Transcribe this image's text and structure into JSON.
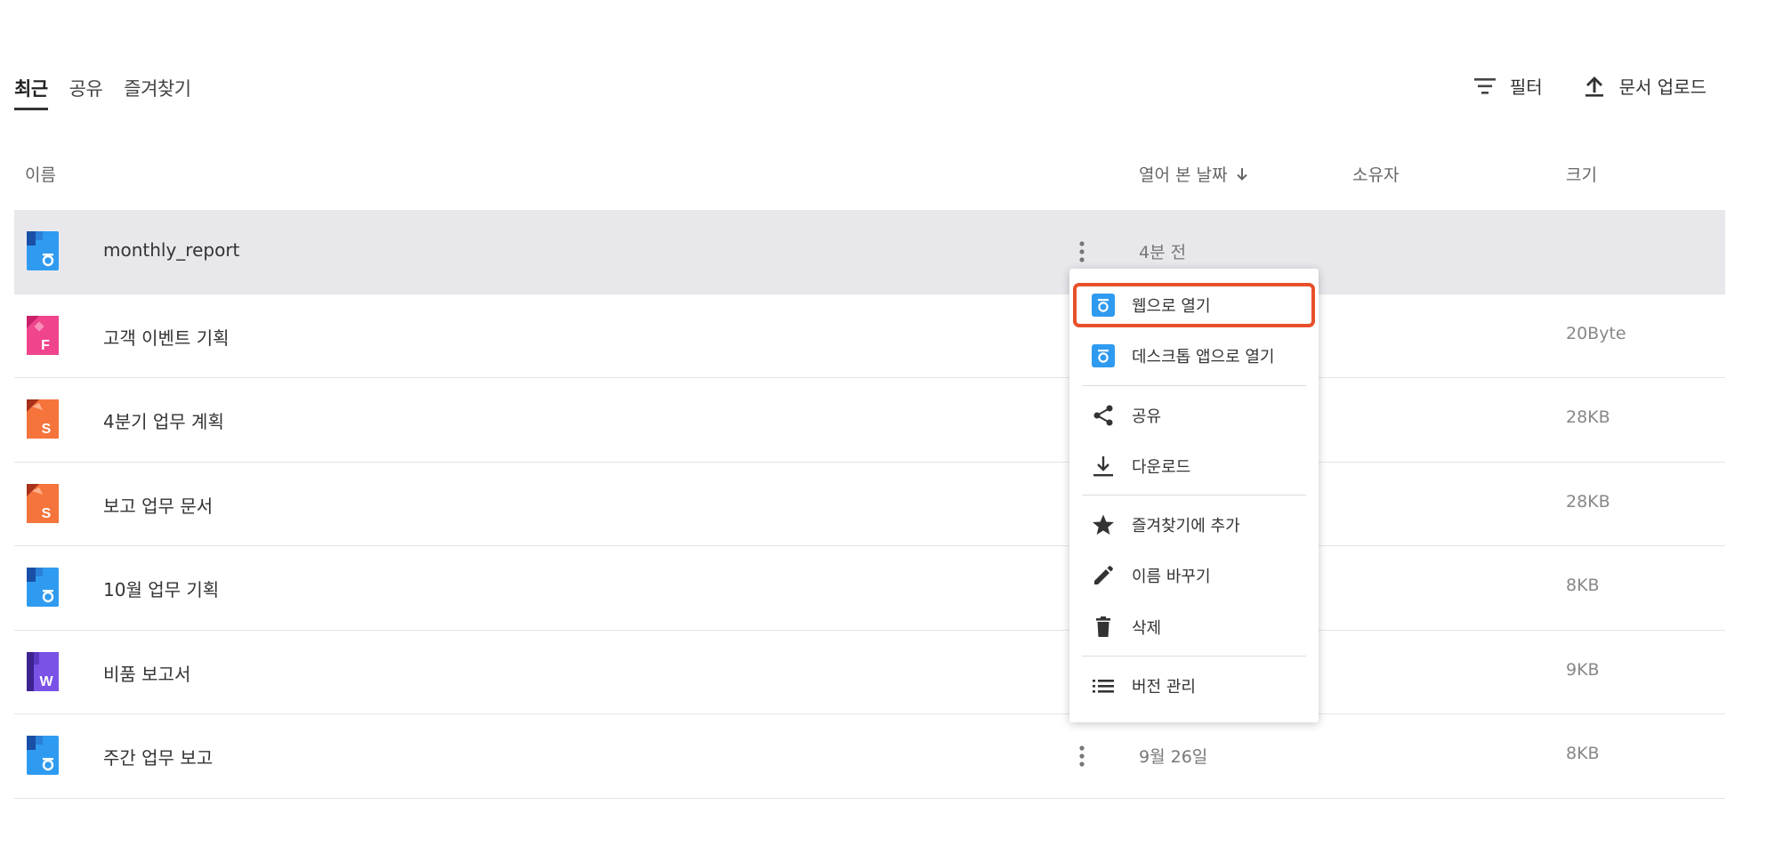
{
  "tabs": [
    {
      "label": "최근",
      "active": true
    },
    {
      "label": "공유",
      "active": false
    },
    {
      "label": "즐겨찾기",
      "active": false
    }
  ],
  "toolbar": {
    "filter_label": "필터",
    "upload_label": "문서 업로드"
  },
  "table": {
    "columns": {
      "name": "이름",
      "opened": "열어 본 날짜",
      "owner": "소유자",
      "size": "크기"
    },
    "rows": [
      {
        "name": "monthly_report",
        "type": "hancom-doc",
        "date": "4분 전",
        "size": "",
        "selected": true
      },
      {
        "name": "고객 이벤트 기획",
        "type": "form-doc",
        "date": "",
        "size": "20Byte"
      },
      {
        "name": "4분기 업무 계획",
        "type": "sheet-doc",
        "date": "",
        "size": "28KB"
      },
      {
        "name": "보고 업무 문서",
        "type": "sheet-doc",
        "date": "",
        "size": "28KB"
      },
      {
        "name": "10월 업무 기획",
        "type": "hancom-doc",
        "date": "",
        "size": "8KB"
      },
      {
        "name": "비품 보고서",
        "type": "word-doc",
        "date": "",
        "size": "9KB"
      },
      {
        "name": "주간 업무 보고",
        "type": "hancom-doc",
        "date": "9월 26일",
        "size": "8KB"
      }
    ]
  },
  "context_menu": {
    "open_web": "웹으로 열기",
    "open_desktop": "데스크톱 앱으로 열기",
    "share": "공유",
    "download": "다운로드",
    "add_favorite": "즐겨찾기에 추가",
    "rename": "이름 바꾸기",
    "delete": "삭제",
    "version": "버전 관리"
  },
  "colors": {
    "highlight_border": "#e8502a",
    "hancom_blue": "#2f9bf0",
    "form_pink": "#f0458c",
    "sheet_orange": "#f5743c",
    "word_purple": "#7a52e6"
  }
}
